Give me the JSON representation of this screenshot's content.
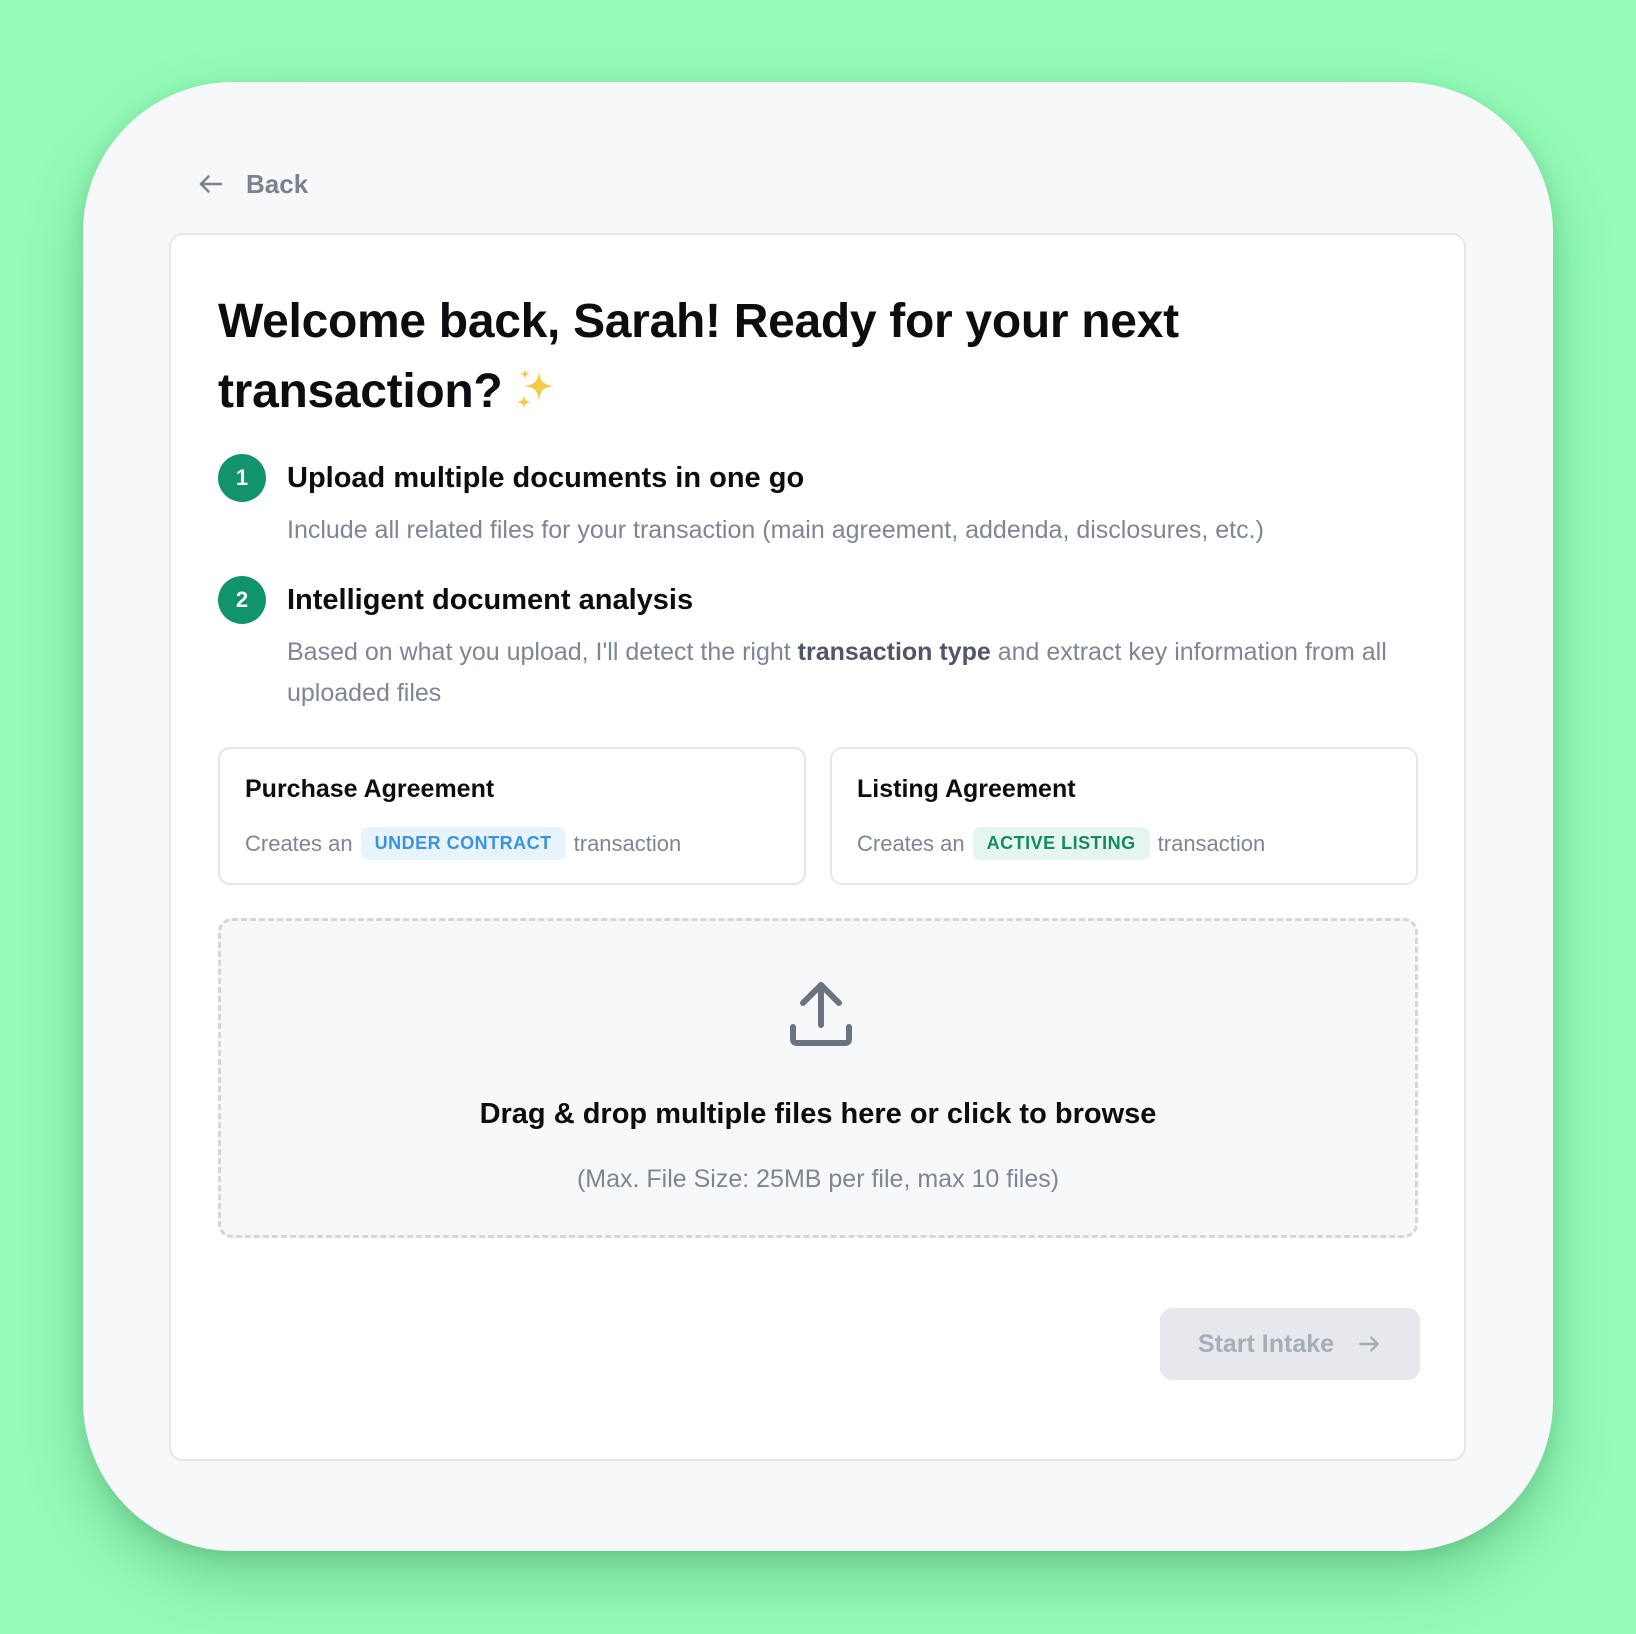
{
  "back": {
    "label": "Back",
    "icon": "arrow-left-icon"
  },
  "welcome": {
    "title": "Welcome back, Sarah! Ready for your next transaction?",
    "emoji": "sparkles-icon"
  },
  "steps": [
    {
      "number": "1",
      "title": "Upload multiple documents in one go",
      "description": "Include all related files for your transaction (main agreement, addenda, disclosures, etc.)"
    },
    {
      "number": "2",
      "title": "Intelligent document analysis",
      "description_before": "Based on what you upload, I'll detect the right ",
      "description_bold": "transaction type",
      "description_after": " and extract key information from all uploaded files"
    }
  ],
  "types": [
    {
      "title": "Purchase Agreement",
      "prefix": "Creates an",
      "badge": "UNDER CONTRACT",
      "suffix": "transaction",
      "badge_color": "#3b93dd"
    },
    {
      "title": "Listing Agreement",
      "prefix": "Creates an",
      "badge": "ACTIVE LISTING",
      "suffix": "transaction",
      "badge_color": "#138a5f"
    }
  ],
  "dropzone": {
    "icon": "upload-icon",
    "title": "Drag & drop multiple files here or click to browse",
    "subtitle": "(Max. File Size: 25MB per file, max 10 files)"
  },
  "start_button": {
    "label": "Start Intake",
    "icon": "arrow-right-icon",
    "disabled": true
  },
  "colors": {
    "background": "#94fbb8",
    "accent_green": "#11946b",
    "badge_blue": "#3b93dd",
    "badge_green": "#138a5f"
  }
}
